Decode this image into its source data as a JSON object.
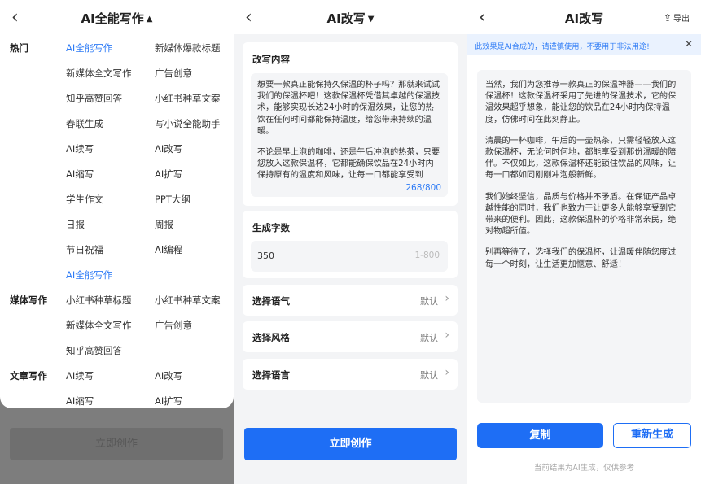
{
  "panel1": {
    "title": "AI全能写作",
    "categories": {
      "hot": "热门",
      "media": "媒体写作",
      "article": "文章写作"
    },
    "items": {
      "a1": "AI全能写作",
      "a2": "新媒体爆款标题",
      "b1": "新媒体全文写作",
      "b2": "广告创意",
      "c1": "知乎高赞回答",
      "c2": "小红书种草文案",
      "d1": "春联生成",
      "d2": "写小说全能助手",
      "e1": "AI续写",
      "e2": "AI改写",
      "f1": "AI缩写",
      "f2": "AI扩写",
      "g1": "学生作文",
      "g2": "PPT大纲",
      "h1": "日报",
      "h2": "周报",
      "i1": "节日祝福",
      "i2": "AI编程",
      "j1": "AI全能写作",
      "k1": "小红书种草标题",
      "k2": "小红书种草文案",
      "l1": "新媒体全文写作",
      "l2": "广告创意",
      "m1": "知乎高赞回答",
      "n1": "AI续写",
      "n2": "AI改写",
      "o1": "AI缩写",
      "o2": "AI扩写"
    },
    "create_label": "立即创作"
  },
  "panel2": {
    "title": "AI改写",
    "content_label": "改写内容",
    "content_p1": "想要一款真正能保持久保温的杯子吗？那就来试试我们的保温杯吧！这款保温杯凭借其卓越的保温技术，能够实现长达24小时的保温效果，让您的热饮在任何时间都能保持温度，给您带来持续的温暖。",
    "content_p2": "不论是早上泡的咖啡，还是午后冲泡的热茶，只要您放入这款保温杯，它都能确保饮品在24小时内保持原有的温度和风味，让每一口都能享受到",
    "counter": "268/800",
    "words_label": "生成字数",
    "words_value": "350",
    "words_range": "1-800",
    "tone_label": "选择语气",
    "style_label": "选择风格",
    "language_label": "选择语言",
    "default_value": "默认",
    "create_label": "立即创作"
  },
  "panel3": {
    "title": "AI改写",
    "export_label": "导出",
    "notice": "此效果是AI合成的，请谨慎使用，不要用于非法用途!",
    "result_p1": "当然，我们为您推荐一款真正的保温神器——我们的保温杯！这款保温杯采用了先进的保温技术，它的保温效果超乎想象，能让您的饮品在24小时内保持温度，仿佛时间在此刻静止。",
    "result_p2": "清晨的一杯咖啡，午后的一壶热茶，只需轻轻放入这款保温杯，无论何时何地，都能享受到那份温暖的陪伴。不仅如此，这款保温杯还能锁住饮品的风味，让每一口都如同刚刚冲泡般新鲜。",
    "result_p3": "我们始终坚信，品质与价格并不矛盾。在保证产品卓越性能的同时，我们也致力于让更多人能够享受到它带来的便利。因此，这款保温杯的价格非常亲民，绝对物超所值。",
    "result_p4": "别再等待了，选择我们的保温杯，让温暖伴随您度过每一个时刻，让生活更加惬意、舒适！",
    "copy_label": "复制",
    "regenerate_label": "重新生成",
    "footnote": "当前结果为AI生成，仅供参考"
  },
  "colors": {
    "accent": "#1e6ef5",
    "link": "#2f7cf6"
  },
  "icons": {
    "back": "chevron-left-icon",
    "caret_up": "caret-up-icon",
    "caret_down": "caret-down-icon",
    "chevron_right": "chevron-right-icon",
    "export": "export-icon",
    "close": "close-icon"
  }
}
